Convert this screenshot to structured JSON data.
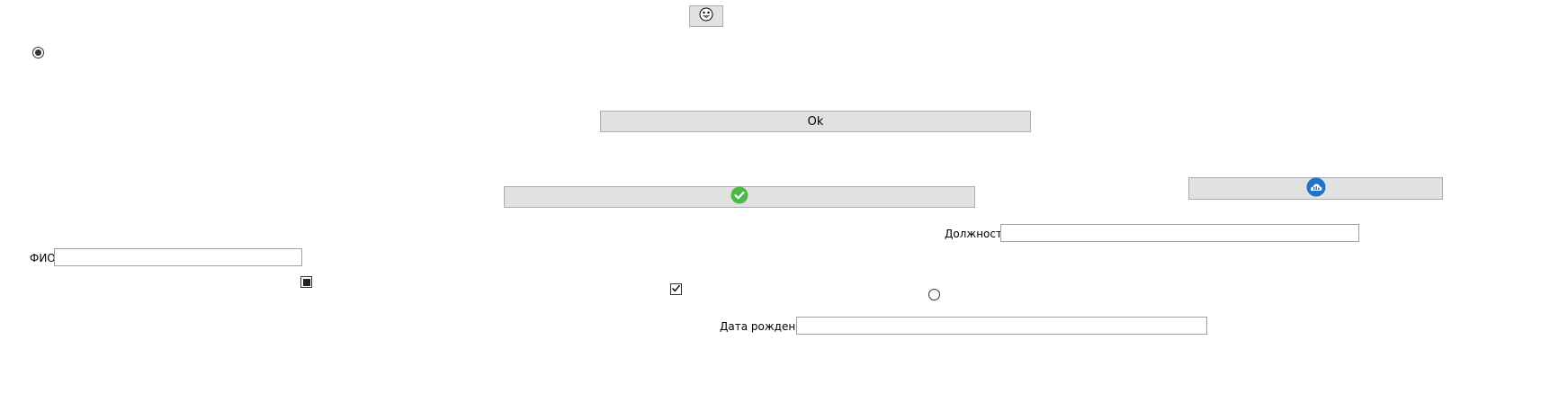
{
  "buttons": {
    "emoji_icon": "emoji-icon",
    "ok_label": "Ok",
    "check_icon": "green-check-icon",
    "cloud_icon": "blue-cloud-icon"
  },
  "fields": {
    "position_label": "Должность",
    "position_value": "",
    "fio_label": "ФИО",
    "fio_value": "",
    "birth_label": "Дата рождения",
    "birth_value": ""
  },
  "controls": {
    "radio_top_checked": true,
    "radio_right_checked": false,
    "checkbox_filled_state": "indeterminate",
    "checkbox_checked": true
  },
  "colors": {
    "button_bg": "#e1e1e1",
    "check_green": "#4fb748",
    "cloud_blue": "#1e72c8"
  }
}
